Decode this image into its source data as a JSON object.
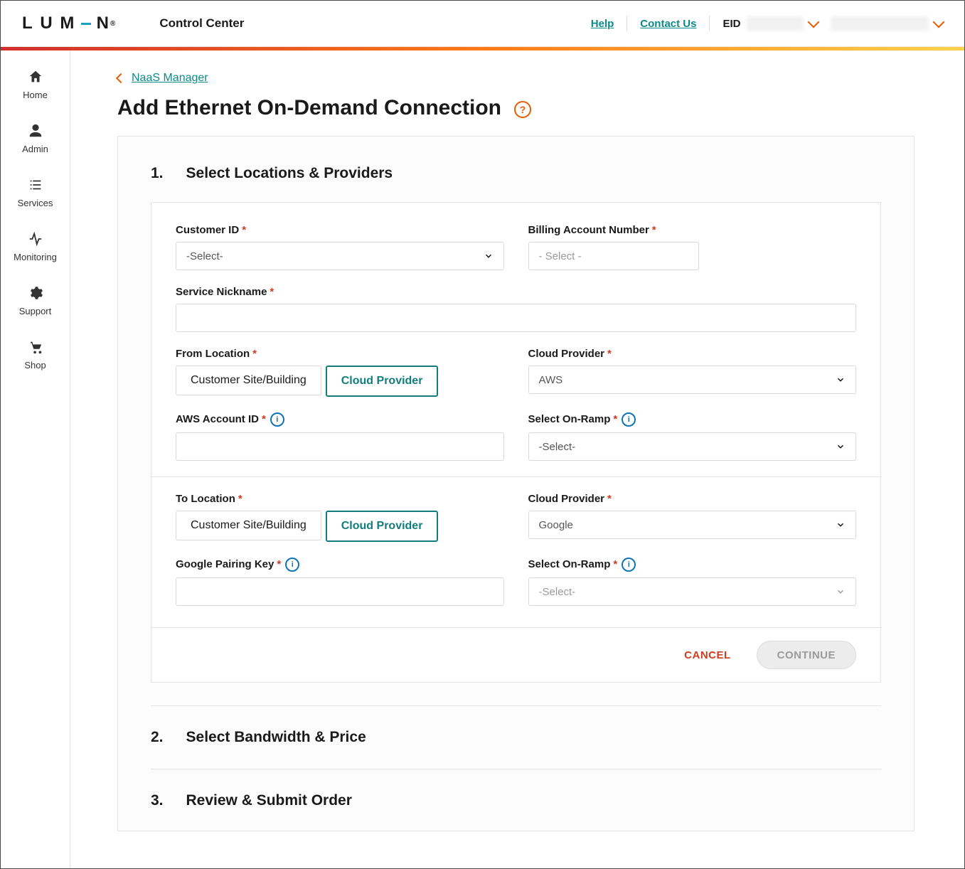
{
  "brand": {
    "name": "LUMEN",
    "app": "Control Center"
  },
  "topnav": {
    "help": "Help",
    "contact": "Contact Us",
    "eid_label": "EID"
  },
  "sidebar": {
    "items": [
      {
        "label": "Home",
        "icon": "home-icon"
      },
      {
        "label": "Admin",
        "icon": "user-icon"
      },
      {
        "label": "Services",
        "icon": "list-icon"
      },
      {
        "label": "Monitoring",
        "icon": "activity-icon"
      },
      {
        "label": "Support",
        "icon": "gear-icon"
      },
      {
        "label": "Shop",
        "icon": "cart-icon"
      }
    ]
  },
  "breadcrumb": {
    "back_label": " NaaS Manager"
  },
  "page": {
    "title": "Add Ethernet On-Demand Connection"
  },
  "steps": {
    "s1_num": "1.",
    "s1_title": "Select Locations & Providers",
    "s2_num": "2.",
    "s2_title": "Select Bandwidth & Price",
    "s3_num": "3.",
    "s3_title": "Review & Submit Order"
  },
  "form": {
    "customer_id_label": "Customer ID",
    "customer_id_value": "-Select-",
    "billing_label": "Billing Account Number",
    "billing_placeholder": "- Select -",
    "nickname_label": "Service Nickname",
    "nickname_value": "",
    "from_label": "From Location",
    "seg_customer": "Customer Site/Building",
    "seg_cloud": "Cloud Provider",
    "cloud_provider_label": "Cloud Provider",
    "from_cloud_value": "AWS",
    "aws_id_label": "AWS Account ID",
    "aws_id_value": "",
    "onramp_label": "Select On-Ramp",
    "from_onramp_value": "-Select-",
    "to_label": "To Location",
    "to_cloud_value": "Google",
    "pairing_label": "Google Pairing Key",
    "pairing_value": "",
    "to_onramp_value": "-Select-",
    "cancel": "CANCEL",
    "continue": "CONTINUE"
  }
}
